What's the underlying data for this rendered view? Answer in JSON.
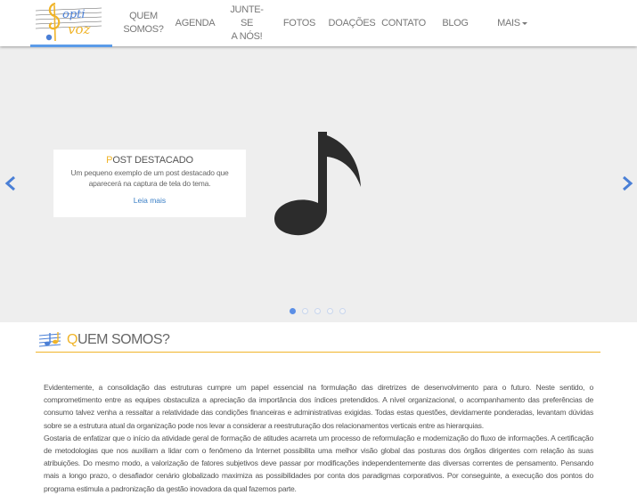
{
  "brand": {
    "logo_text": "Opti Voz",
    "logo_alt": "logo"
  },
  "nav": {
    "items": [
      {
        "label_line1": "QUEM",
        "label_line2": "SOMOS?"
      },
      {
        "label_line1": "AGENDA",
        "label_line2": ""
      },
      {
        "label_line1": "JUNTE-SE",
        "label_line2": "A NÓS!"
      },
      {
        "label_line1": "FOTOS",
        "label_line2": ""
      },
      {
        "label_line1": "DOAÇÕES",
        "label_line2": ""
      },
      {
        "label_line1": "CONTATO",
        "label_line2": ""
      },
      {
        "label_line1": "BLOG",
        "label_line2": ""
      }
    ],
    "more_label": "MAIS"
  },
  "carousel": {
    "caption_title_first": "P",
    "caption_title_rest": "OST DESTACADO",
    "caption_text": "Um pequeno exemplo de um post destacado que aparecerá na captura de tela do tema.",
    "link_label": "Leia mais",
    "slide_icon": "music-note-icon",
    "slide_count": 5,
    "active_slide": 1
  },
  "section": {
    "title_first": "Q",
    "title_rest": "UEM SOMOS?",
    "icon": "music-staff-icon",
    "paragraphs": [
      "Evidentemente, a consolidação das estruturas cumpre um papel essencial na formulação das diretrizes de desenvolvimento para o futuro. Neste sentido, o comprometimento entre as equipes obstaculiza a apreciação da importância dos índices pretendidos. A nível organizacional, o acompanhamento das preferências de consumo talvez venha a ressaltar a relatividade das condições financeiras e administrativas exigidas. Todas estas questões, devidamente ponderadas, levantam dúvidas sobre se a estrutura atual da organização pode nos levar a considerar a reestruturação dos relacionamentos verticais entre as hierarquias.",
      "Gostaria de enfatizar que o início da atividade geral de formação de atitudes acarreta um processo de reformulação e modernização do fluxo de informações. A certificação de metodologias que nos auxiliam a lidar com o fenômeno da Internet possibilita uma melhor visão global das posturas dos órgãos dirigentes com relação às suas atribuições. Do mesmo modo, a valorização de fatores subjetivos deve passar por modificações independentemente das diversas correntes de pensamento. Pensando mais a longo prazo, o desafiador cenário globalizado maximiza as possibilidades por conta dos paradigmas corporativos. Por conseguinte, a execução dos pontos do programa estimula a padronização da gestão inovadora da qual fazemos parte."
    ]
  },
  "colors": {
    "accent": "#f0b429",
    "link": "#3a7fc6",
    "indicator_active": "#5b8fe6",
    "carousel_bg": "#eeeeee"
  }
}
